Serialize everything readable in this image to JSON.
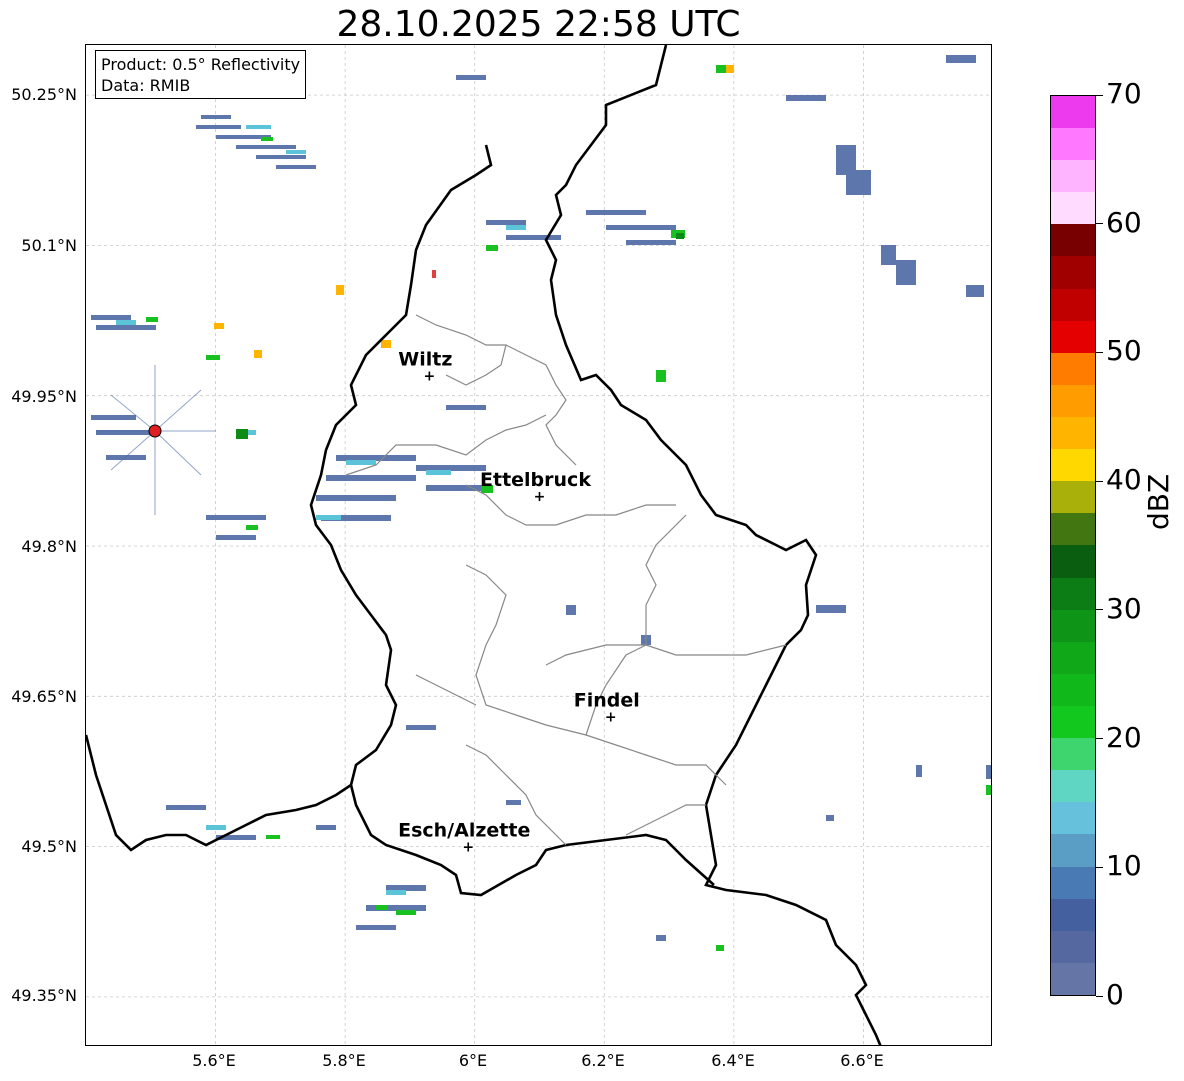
{
  "title": "28.10.2025 22:58 UTC",
  "info": {
    "product": "Product: 0.5° Reflectivity",
    "data": "Data: RMIB"
  },
  "map": {
    "lon_range": [
      5.4,
      6.8
    ],
    "lat_range": [
      49.3,
      50.3
    ],
    "lat_ticks": [
      "50.25°N",
      "50.1°N",
      "49.95°N",
      "49.8°N",
      "49.65°N",
      "49.5°N",
      "49.35°N"
    ],
    "lon_ticks": [
      "5.6°E",
      "5.8°E",
      "6°E",
      "6.2°E",
      "6.4°E",
      "6.6°E"
    ],
    "gridlines": true,
    "radar_marker_color": "#e02020",
    "cities": [
      {
        "name": "Wiltz",
        "lon": 5.93,
        "lat": 49.97
      },
      {
        "name": "Ettelbruck",
        "lon": 6.1,
        "lat": 49.85
      },
      {
        "name": "Findel",
        "lon": 6.21,
        "lat": 49.63
      },
      {
        "name": "Esch/Alzette",
        "lon": 5.99,
        "lat": 49.5
      }
    ]
  },
  "colorbar": {
    "label": "dBZ",
    "min": 0,
    "max": 70,
    "ticks": [
      "0",
      "10",
      "20",
      "30",
      "40",
      "50",
      "60",
      "70"
    ],
    "colors": [
      "#6475a6",
      "#5568a0",
      "#44609e",
      "#4a7ab3",
      "#5a9ec6",
      "#66c1dc",
      "#5fd6c4",
      "#3ed56e",
      "#12c81e",
      "#10b81a",
      "#10a818",
      "#0e9416",
      "#0c7c14",
      "#0a5e10",
      "#427610",
      "#aab00a",
      "#ffd800",
      "#ffb400",
      "#ff9c00",
      "#ff7c00",
      "#e40000",
      "#c00000",
      "#a00000",
      "#780000",
      "#ffdcff",
      "#ffb4ff",
      "#ff78ff",
      "#ee3aee"
    ]
  }
}
